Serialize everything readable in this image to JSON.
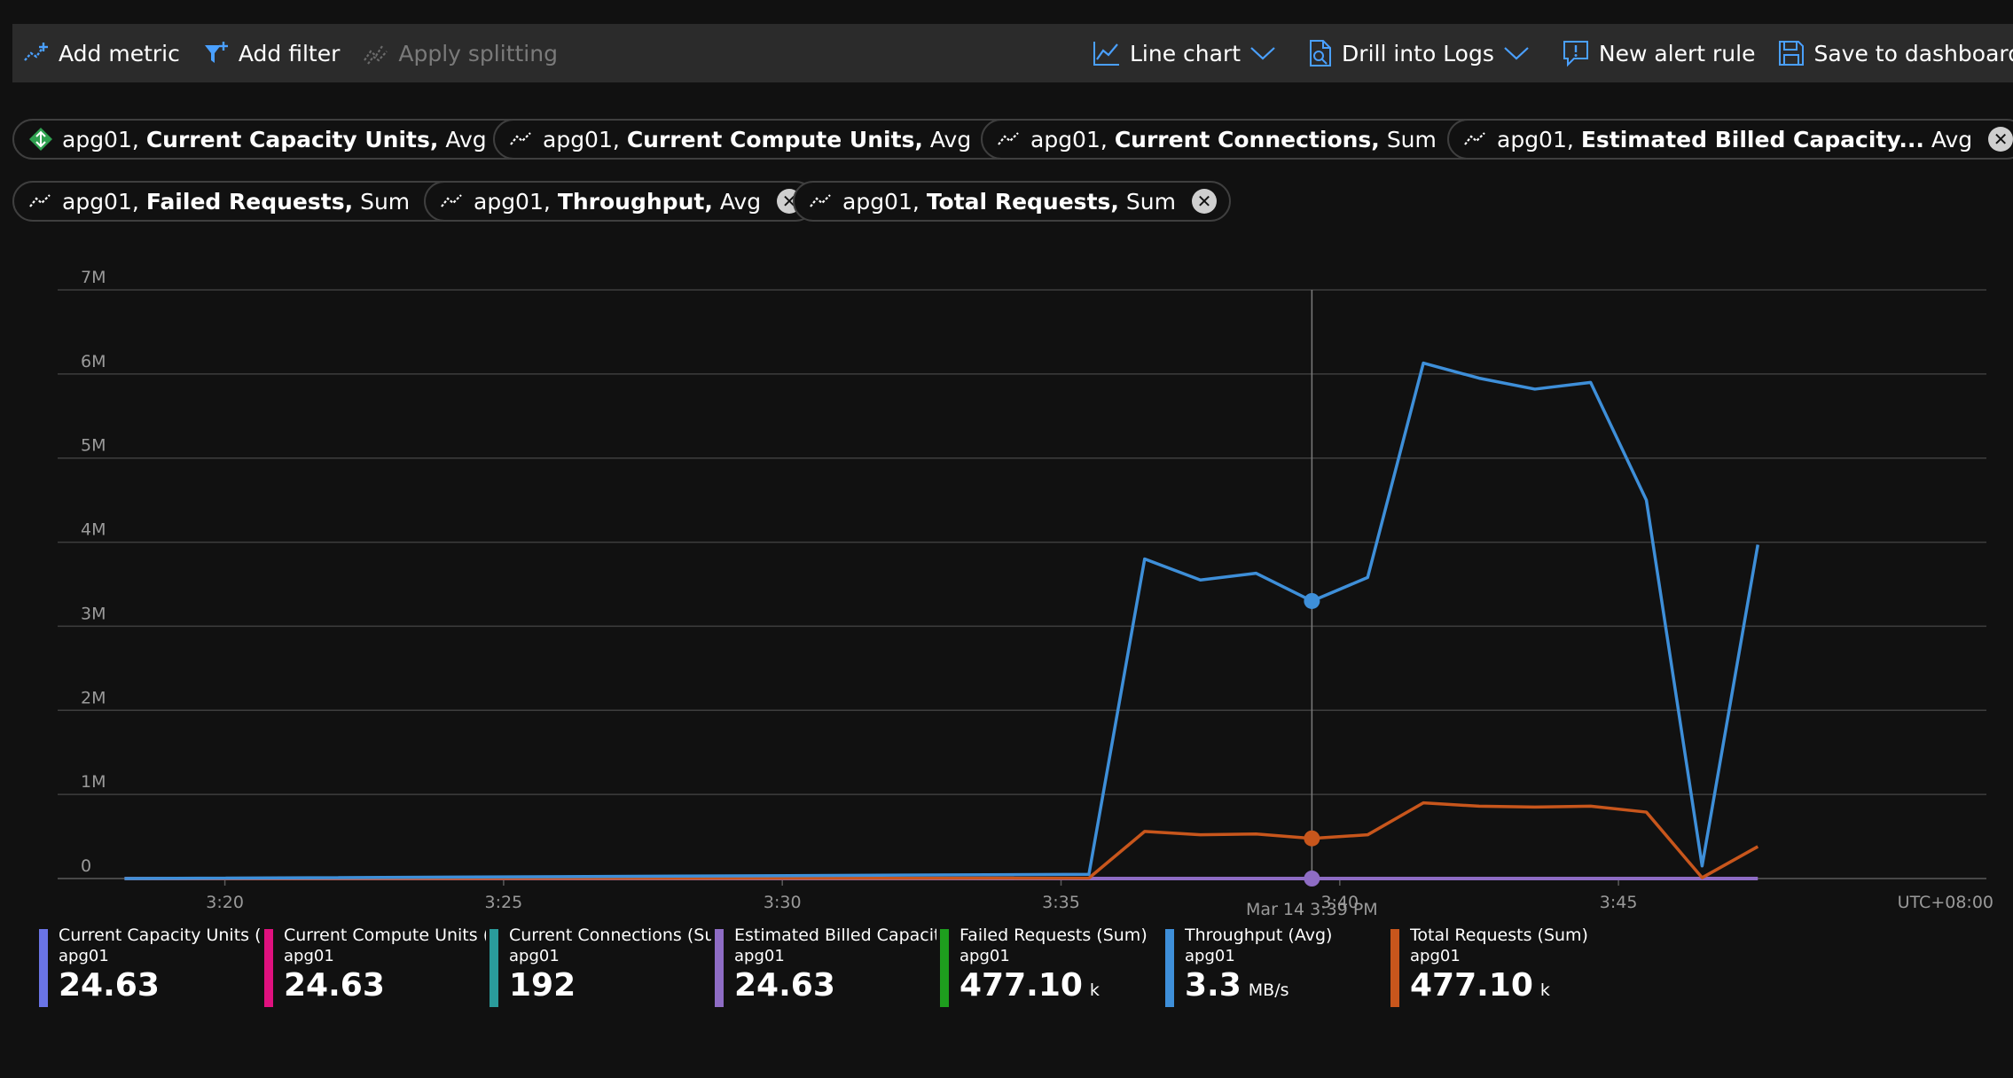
{
  "toolbar": {
    "add_metric": "Add metric",
    "add_filter": "Add filter",
    "apply_splitting": "Apply splitting",
    "line_chart": "Line chart",
    "drill_logs": "Drill into Logs",
    "new_alert": "New alert rule",
    "save_dashboard": "Save to dashboard"
  },
  "pills": [
    {
      "resource": "apg01,",
      "metric": "Current Capacity Units,",
      "agg": "Avg"
    },
    {
      "resource": "apg01,",
      "metric": "Current Compute Units,",
      "agg": "Avg"
    },
    {
      "resource": "apg01,",
      "metric": "Current Connections,",
      "agg": "Sum"
    },
    {
      "resource": "apg01,",
      "metric": "Estimated Billed Capacity...",
      "agg": "Avg"
    },
    {
      "resource": "apg01,",
      "metric": "Failed Requests,",
      "agg": "Sum"
    },
    {
      "resource": "apg01,",
      "metric": "Throughput,",
      "agg": "Avg"
    },
    {
      "resource": "apg01,",
      "metric": "Total Requests,",
      "agg": "Sum"
    }
  ],
  "chart_data": {
    "type": "line",
    "y_ticks": [
      "0",
      "1M",
      "2M",
      "3M",
      "4M",
      "5M",
      "6M",
      "7M"
    ],
    "ylim": [
      0,
      7000000
    ],
    "x_ticks": [
      "3:20",
      "3:25",
      "3:30",
      "3:35",
      "3:40",
      "3:45"
    ],
    "timezone_label": "UTC+08:00",
    "cursor_label": "Mar 14 3:39 PM",
    "cursor_time_min": 39.5,
    "x_range_min": [
      18.2,
      47.5
    ],
    "series": [
      {
        "key": "throughput",
        "color": "#3e8fd9",
        "x": [
          18.2,
          35.5,
          36.5,
          37.5,
          38.5,
          39.5,
          40.5,
          41.5,
          42.5,
          43.5,
          44.5,
          45.5,
          46.5,
          47.5
        ],
        "values": [
          0,
          50000,
          3800000,
          3550000,
          3630000,
          3300000,
          3580000,
          6130000,
          5950000,
          5820000,
          5900000,
          4500000,
          150000,
          3970000
        ]
      },
      {
        "key": "total-requests",
        "color": "#c8561c",
        "x": [
          18.2,
          35.5,
          36.5,
          37.5,
          38.5,
          39.5,
          40.5,
          41.5,
          42.5,
          43.5,
          44.5,
          45.5,
          46.5,
          47.5
        ],
        "values": [
          0,
          5000,
          560000,
          520000,
          530000,
          477100,
          520000,
          900000,
          860000,
          850000,
          860000,
          790000,
          10000,
          380000
        ]
      },
      {
        "key": "estimated-billed",
        "color": "#8e6cc4",
        "x": [
          18.2,
          47.5
        ],
        "values": [
          0,
          0
        ]
      }
    ],
    "markers": [
      {
        "series": "throughput",
        "x": 39.5,
        "y": 3300000
      },
      {
        "series": "total-requests",
        "x": 39.5,
        "y": 477100
      },
      {
        "series": "estimated-billed",
        "x": 39.5,
        "y": 0
      }
    ]
  },
  "legend": [
    {
      "name": "Current Capacity Units (Avg)",
      "resource": "apg01",
      "value": "24.63",
      "unit": "",
      "color": "#6a74e6"
    },
    {
      "name": "Current Compute Units (A...",
      "resource": "apg01",
      "value": "24.63",
      "unit": "",
      "color": "#e0117f"
    },
    {
      "name": "Current Connections (Sum)",
      "resource": "apg01",
      "value": "192",
      "unit": "",
      "color": "#2a9b9b"
    },
    {
      "name": "Estimated Billed Capacity ...",
      "resource": "apg01",
      "value": "24.63",
      "unit": "",
      "color": "#8e6cc4"
    },
    {
      "name": "Failed Requests (Sum)",
      "resource": "apg01",
      "value": "477.10",
      "unit": "k",
      "color": "#1e9e1e"
    },
    {
      "name": "Throughput (Avg)",
      "resource": "apg01",
      "value": "3.3",
      "unit": "MB/s",
      "color": "#3e8fd9"
    },
    {
      "name": "Total Requests (Sum)",
      "resource": "apg01",
      "value": "477.10",
      "unit": "k",
      "color": "#c8561c"
    }
  ]
}
